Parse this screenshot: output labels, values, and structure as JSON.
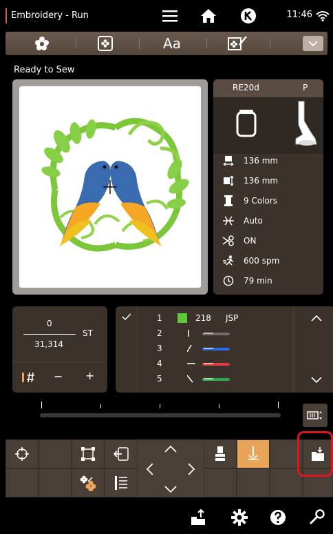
{
  "app_title": "Embroidery - Run",
  "clock": "11:46",
  "status": "Ready to Sew",
  "tabs": {
    "text_tab_label": "Aa"
  },
  "info": {
    "hoop_name": "RE20d",
    "presser_foot": "P",
    "rows": [
      {
        "icon": "width-icon",
        "value": "136 mm"
      },
      {
        "icon": "height-icon",
        "value": "136 mm"
      },
      {
        "icon": "thread-spool-icon",
        "value": "9 Colors"
      },
      {
        "icon": "tension-icon",
        "value": "Auto"
      },
      {
        "icon": "thread-cutter-icon",
        "value": "ON"
      },
      {
        "icon": "speed-runner-icon",
        "value": "600 spm"
      },
      {
        "icon": "clock-icon",
        "value": "79 min"
      }
    ]
  },
  "counter": {
    "current": "0",
    "total": "31,314",
    "unit": "ST",
    "minus": "−",
    "plus": "+"
  },
  "threads": {
    "rows": [
      {
        "index": "1",
        "color": "#5cc83a",
        "number": "218",
        "brand": "JSP"
      },
      {
        "index": "2",
        "color": "#6e6e6e"
      },
      {
        "index": "3",
        "color": "#2c6ee0"
      },
      {
        "index": "4",
        "color": "#e03a3a"
      },
      {
        "index": "5",
        "color": "#2ea84a"
      }
    ]
  },
  "colors": {
    "accent": "#c8643c",
    "highlight": "#e0161c",
    "panel": "#3b322c",
    "active_tool": "#e8a55a"
  }
}
